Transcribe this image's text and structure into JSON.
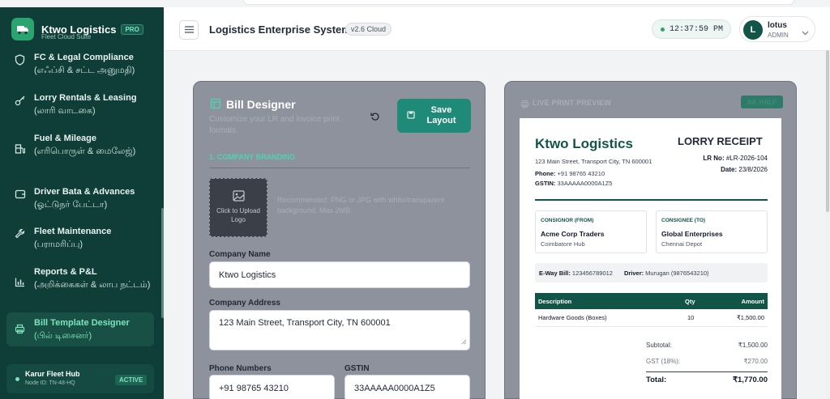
{
  "brand": {
    "name": "Ktwo Logistics",
    "badge": "PRO",
    "subtitle": "Fleet Cloud Suite"
  },
  "sidebar": {
    "items": [
      {
        "label": "FC & Legal Compliance",
        "tamil": "(எஃப்சி & சட்ட அனுமதி)",
        "icon": "shield-icon"
      },
      {
        "label": "Lorry Rentals & Leasing",
        "tamil": "(லாரி வாடகை)",
        "icon": "key-icon"
      },
      {
        "label": "Fuel & Mileage",
        "tamil": "(எரிபொருள் & மைலேஜ்)",
        "icon": "fuel-icon"
      },
      {
        "label": "Driver Bata & Advances",
        "tamil": "(ஓட்டுநர் பேட்டா)",
        "icon": "wallet-icon"
      },
      {
        "label": "Fleet Maintenance",
        "tamil": "(பராமரிப்பு)",
        "icon": "wrench-icon"
      },
      {
        "label": "Reports & P&L",
        "tamil": "(அறிக்கைகள் & லாப நட்டம்)",
        "icon": "bar-chart-icon"
      },
      {
        "label": "Bill Template Designer",
        "tamil": "(பில் டிசைனர்)",
        "icon": "printer-icon",
        "active": true
      }
    ],
    "hub": {
      "name": "Karur Fleet Hub",
      "node": "Node ID: TN-48-HQ",
      "status": "ACTIVE"
    }
  },
  "header": {
    "title": "Logistics Enterprise System",
    "version": "v2.6 Cloud",
    "clock": "12:37:59 PM",
    "user": {
      "initial": "L",
      "name": "lotus",
      "role": "ADMIN"
    }
  },
  "designer": {
    "title": "Bill Designer",
    "subtitle": "Customize your LR and invoice print formats.",
    "save_label": "Save Layout",
    "section": "1. COMPANY BRANDING",
    "upload_label": "Click to Upload Logo",
    "upload_hint": "Recommended: PNG or JPG with white/transparent background. Max 2MB.",
    "company_name_label": "Company Name",
    "company_name_value": "Ktwo Logistics",
    "company_address_label": "Company Address",
    "company_address_value": "123 Main Street, Transport City, TN 600001",
    "phone_label": "Phone Numbers",
    "phone_value": "+91 98765 43210",
    "gstin_label": "GSTIN",
    "gstin_value": "33AAAAA0000A1Z5"
  },
  "preview": {
    "label": "LIVE PRINT PREVIEW",
    "size_badge": "A4_HALF",
    "company": "Ktwo Logistics",
    "address": "123 Main Street, Transport City, TN 600001",
    "phone_key": "Phone:",
    "phone": "+91 98765 43210",
    "gstin_key": "GSTIN:",
    "gstin": "33AAAAA0000A1Z5",
    "doc_title": "LORRY RECEIPT",
    "lr_key": "LR No:",
    "lr_no": "#LR-2026-104",
    "date_key": "Date:",
    "date": "23/8/2026",
    "consignor": {
      "head": "CONSIGNOR (FROM)",
      "name": "Acme Corp Traders",
      "city": "Coimbatore Hub"
    },
    "consignee": {
      "head": "CONSIGNEE (TO)",
      "name": "Global Enterprises",
      "city": "Chennai Depot"
    },
    "eway_key": "E-Way Bill:",
    "eway": "123456789012",
    "driver_key": "Driver:",
    "driver": "Murugan (9876543210)",
    "table": {
      "headers": [
        "Description",
        "Qty",
        "Amount"
      ],
      "rows": [
        [
          "Hardware Goods (Boxes)",
          "10",
          "₹1,500.00"
        ]
      ]
    },
    "subtotal_label": "Subtotal:",
    "subtotal": "₹1,500.00",
    "gst_label": "GST (18%):",
    "gst": "₹270.00",
    "total_label": "Total:",
    "total": "₹1,770.00"
  }
}
